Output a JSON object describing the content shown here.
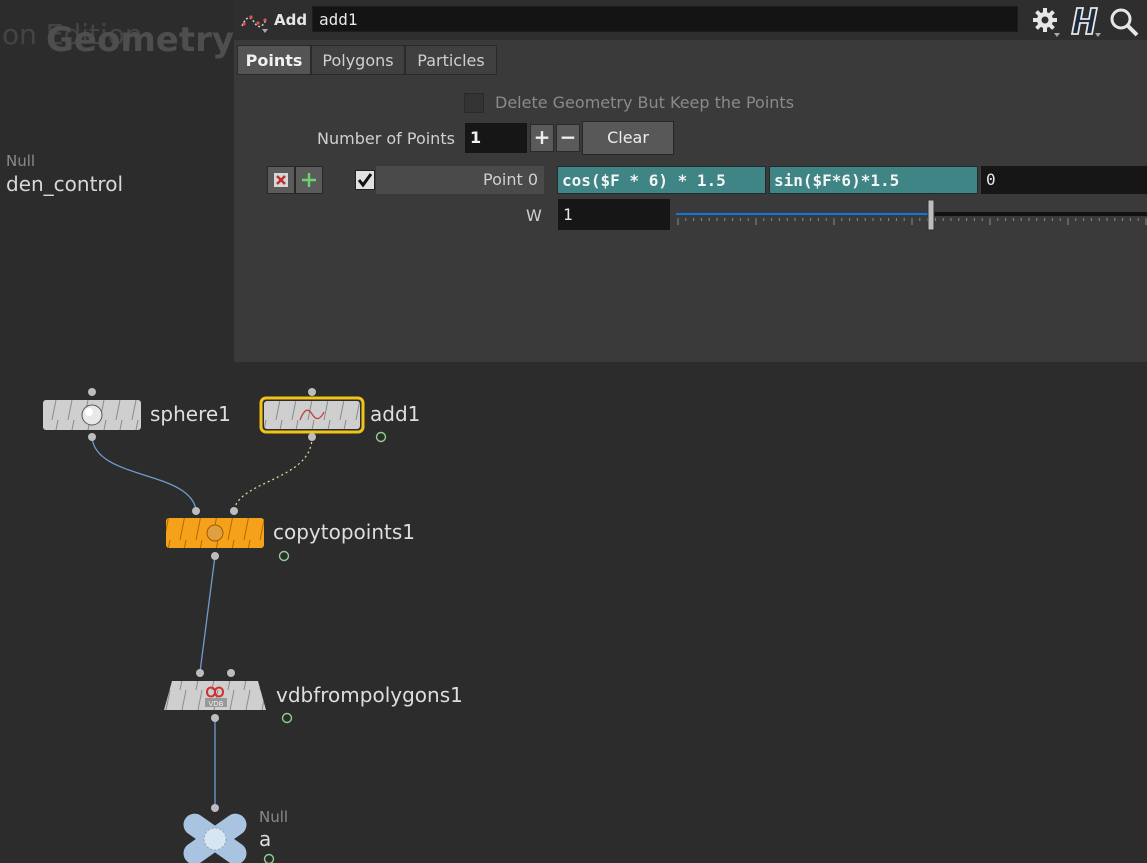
{
  "watermark": {
    "edition": "on Edition",
    "context": "Geometry"
  },
  "selected_null": {
    "type": "Null",
    "name": "den_control"
  },
  "header": {
    "op_type": "Add",
    "node_name": "add1"
  },
  "tabs": [
    {
      "label": "Points",
      "active": true
    },
    {
      "label": "Polygons",
      "active": false
    },
    {
      "label": "Particles",
      "active": false
    }
  ],
  "params": {
    "delete_geometry_label": "Delete Geometry But Keep the Points",
    "delete_geometry_checked": false,
    "num_points_label": "Number of Points",
    "num_points_value": "1",
    "plus_label": "+",
    "minus_label": "−",
    "clear_label": "Clear",
    "point0": {
      "label": "Point 0",
      "enabled": true,
      "x_expr": "cos($F * 6) * 1.5",
      "y_expr": "sin($F*6)*1.5",
      "z_value": "0"
    },
    "w_label": "W",
    "w_value": "1"
  },
  "network": {
    "nodes": [
      {
        "id": "sphere1",
        "label": "sphere1"
      },
      {
        "id": "add1",
        "label": "add1"
      },
      {
        "id": "copytopoints1",
        "label": "copytopoints1"
      },
      {
        "id": "vdbfrompolygons1",
        "label": "vdbfrompolygons1",
        "badge": "VDB"
      },
      {
        "id": "null_a",
        "type": "Null",
        "label": "a"
      }
    ]
  },
  "colors": {
    "expression_bg": "#3f8585",
    "copy_node": "#f5a21a",
    "selected_outline": "#f0c419",
    "wire": "#6e9ccc"
  }
}
